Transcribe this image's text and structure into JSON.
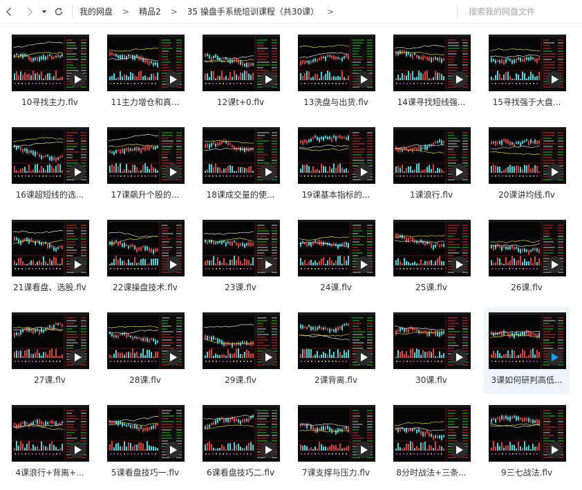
{
  "nav": {
    "back_icon": "chevron-left-icon",
    "forward_icon": "chevron-right-icon",
    "history_icon": "caret-down-icon",
    "refresh_icon": "refresh-icon"
  },
  "breadcrumb": {
    "items": [
      "我的网盘",
      "精品2",
      "35 操盘手系统培训课程（共30课）"
    ],
    "separator": ">"
  },
  "search": {
    "placeholder": "搜索我的网盘文件"
  },
  "files": [
    {
      "name": "10寻找主力.flv"
    },
    {
      "name": "11主力增仓和真..."
    },
    {
      "name": "12课t+0.flv"
    },
    {
      "name": "13洗盘与出货.flv"
    },
    {
      "name": "14课寻找短线强..."
    },
    {
      "name": "15寻找强于大盘..."
    },
    {
      "name": "16课超短线的选..."
    },
    {
      "name": "17课飙升个股的..."
    },
    {
      "name": "18课成交量的使..."
    },
    {
      "name": "19课基本指标的..."
    },
    {
      "name": "1课浪行.flv"
    },
    {
      "name": "20课讲均线.flv"
    },
    {
      "name": "21课看盘、选股.flv"
    },
    {
      "name": "22课操盘技术.flv"
    },
    {
      "name": "23课.flv"
    },
    {
      "name": "24课.flv"
    },
    {
      "name": "25课.flv"
    },
    {
      "name": "26课.flv"
    },
    {
      "name": "27课.flv"
    },
    {
      "name": "28课.flv"
    },
    {
      "name": "29课.flv"
    },
    {
      "name": "2课背离.flv"
    },
    {
      "name": "30课.flv"
    },
    {
      "name": "3课如何研判高低...",
      "selected": true
    },
    {
      "name": "4课浪行+背离+..."
    },
    {
      "name": "5课看盘技巧一.flv"
    },
    {
      "name": "6课看盘技巧二.flv"
    },
    {
      "name": "7课支撑与压力.flv"
    },
    {
      "name": "8分时战法+三条..."
    },
    {
      "name": "9三七战法.flv"
    }
  ],
  "file_icon": "play-icon",
  "colors": {
    "accent": "#1e9bef",
    "selected_bg": "#eef6fd",
    "text": "#333333",
    "placeholder": "#a9a9a9"
  }
}
